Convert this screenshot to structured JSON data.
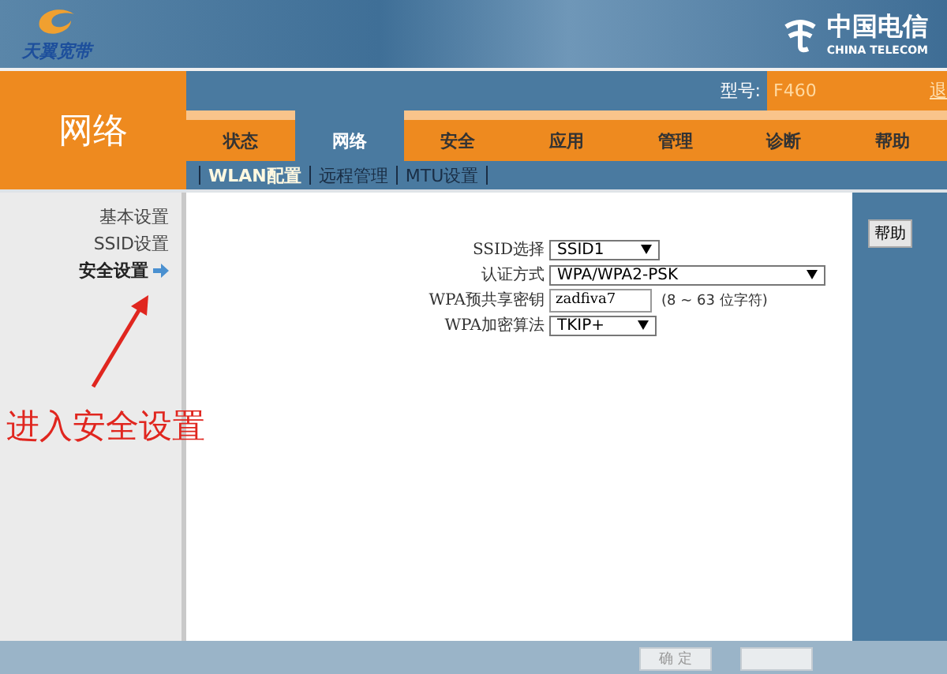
{
  "brand": {
    "left_logo": "天翼宽带",
    "right_logo_cn": "中国电信",
    "right_logo_en": "CHINA TELECOM"
  },
  "section_title": "网络",
  "model": {
    "label": "型号:",
    "value": "F460",
    "logout": "退"
  },
  "tabs": [
    {
      "label": "状态",
      "selected": false
    },
    {
      "label": "网络",
      "selected": true
    },
    {
      "label": "安全",
      "selected": false
    },
    {
      "label": "应用",
      "selected": false
    },
    {
      "label": "管理",
      "selected": false
    },
    {
      "label": "诊断",
      "selected": false
    },
    {
      "label": "帮助",
      "selected": false
    }
  ],
  "subnav": [
    {
      "label": "WLAN配置",
      "selected": true
    },
    {
      "label": "远程管理",
      "selected": false
    },
    {
      "label": "MTU设置",
      "selected": false
    }
  ],
  "sidebar": {
    "items": [
      {
        "label": "基本设置",
        "selected": false
      },
      {
        "label": "SSID设置",
        "selected": false
      },
      {
        "label": "安全设置",
        "selected": true
      }
    ]
  },
  "form": {
    "fields": [
      {
        "kind": "select",
        "label": "SSID选择",
        "value": "SSID1"
      },
      {
        "kind": "select",
        "label": "认证方式",
        "value": "WPA/WPA2-PSK"
      },
      {
        "kind": "text",
        "label": "WPA预共享密钥",
        "value": "zadfiva7",
        "hint": "(8 ~ 63 位字符)"
      },
      {
        "kind": "select",
        "label": "WPA加密算法",
        "value": "TKIP+"
      }
    ]
  },
  "help_button": "帮助",
  "footer": {
    "confirm": "确 定"
  },
  "annotation": {
    "text": "进入安全设置"
  }
}
